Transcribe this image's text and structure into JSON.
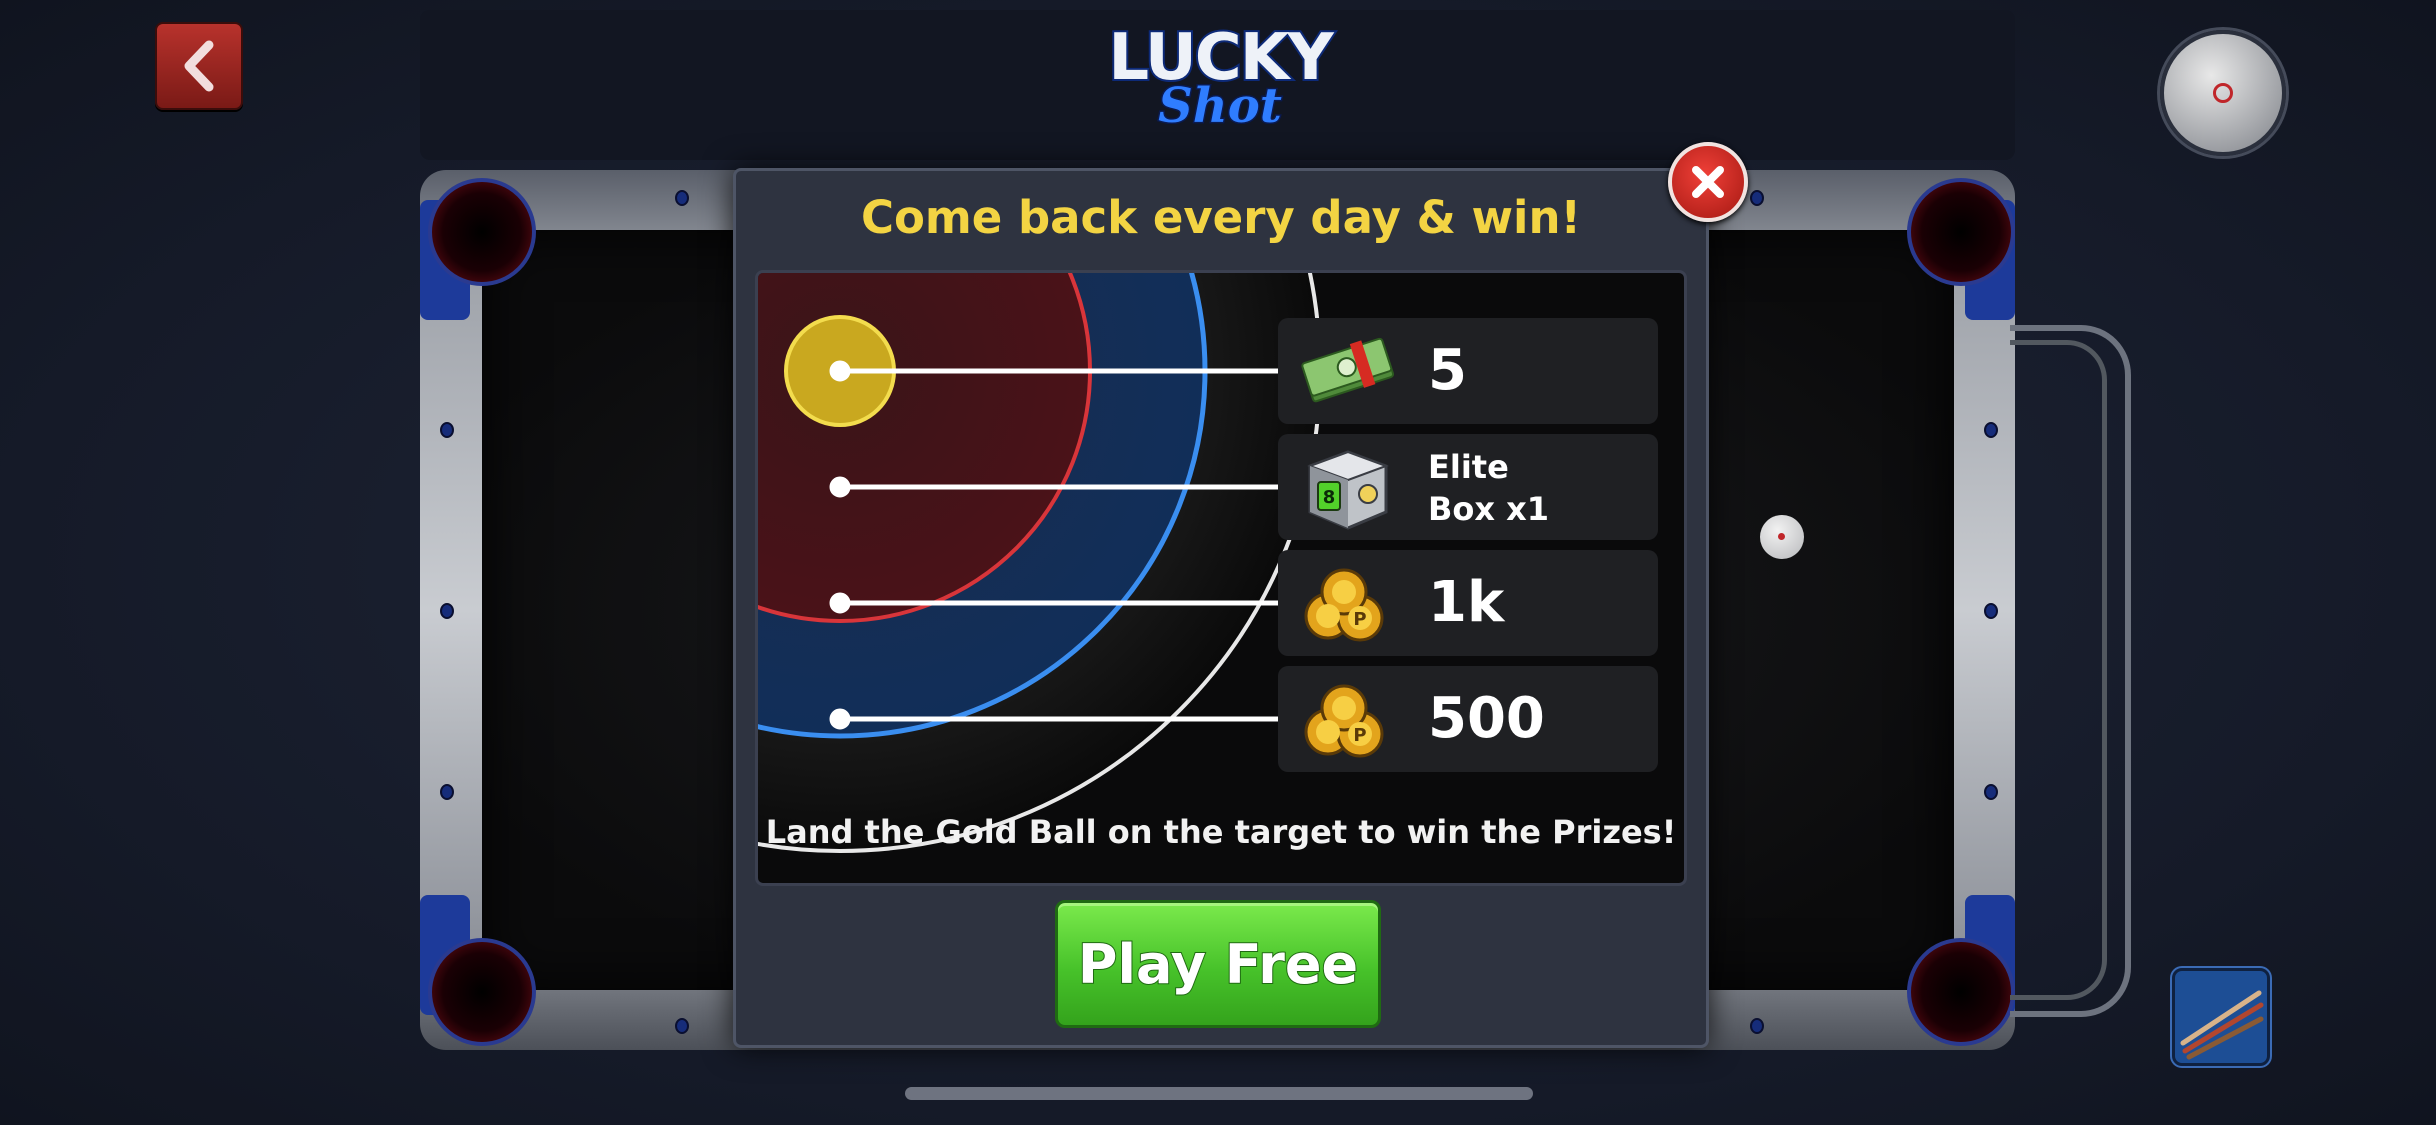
{
  "header": {
    "logo_line1": "LUCKY",
    "logo_line2": "Shot"
  },
  "modal": {
    "title": "Come back every day & win!",
    "prizes": [
      {
        "icon": "cash-icon",
        "value": "5"
      },
      {
        "icon": "elite-box-icon",
        "value": "Elite\nBox x1",
        "line1": "Elite",
        "line2": "Box x1"
      },
      {
        "icon": "coins-icon",
        "value": "1k"
      },
      {
        "icon": "coins-icon",
        "value": "500"
      }
    ],
    "instruction": "Land the Gold Ball on the target to win the Prizes!",
    "play_button": "Play Free"
  },
  "colors": {
    "title": "#f3d443",
    "play_button": "#47c22a",
    "close_button": "#d1261d",
    "ring_red": "#d8353a",
    "ring_blue": "#3a8ef0",
    "gold_ball": "#e8c62a"
  }
}
